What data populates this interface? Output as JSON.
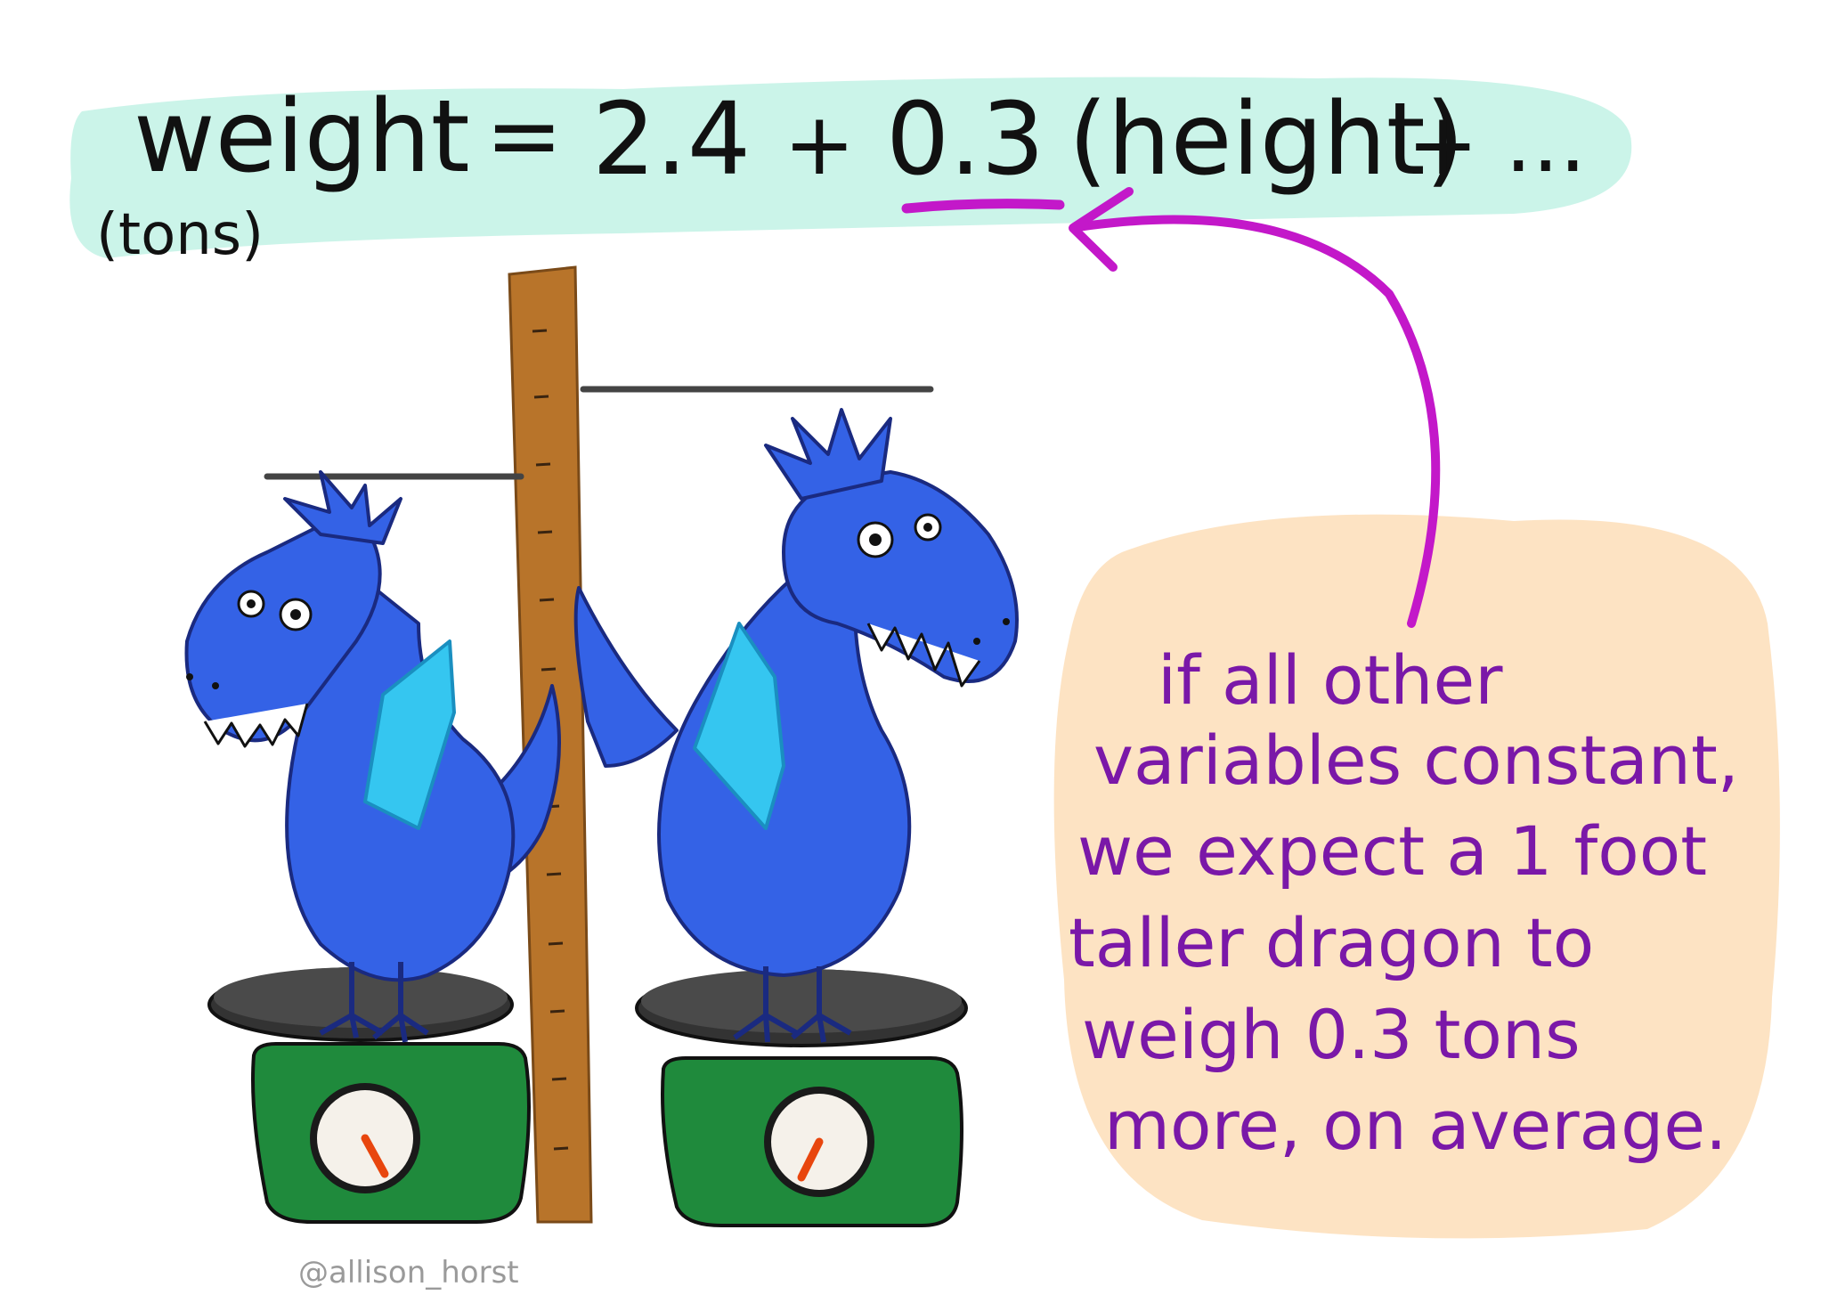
{
  "equation": {
    "lhs": "weight",
    "lhs_unit": "(tons)",
    "equals": "=",
    "intercept": "2.4",
    "plus1": "+",
    "coefficient": "0.3",
    "predictor": "(height)",
    "plus2": "+",
    "ellipsis": "..."
  },
  "annotation": {
    "lines": [
      "if all other",
      "variables constant,",
      "we expect a 1 foot",
      "taller dragon to",
      "weigh 0.3 tons",
      "more, on average."
    ]
  },
  "credit": "@allison_horst",
  "colors": {
    "equation_highlight": "#c8f3e8",
    "annotation_highlight": "#fde2c0",
    "arrow": "#c318c9",
    "annotation_text": "#7a18a8",
    "dragon_body": "#3462e6",
    "dragon_wing": "#35c6f0",
    "ruler": "#b8742a",
    "scale_base": "#1f8a3c",
    "scale_plate": "#3a3a3a",
    "needle": "#e8460e"
  }
}
